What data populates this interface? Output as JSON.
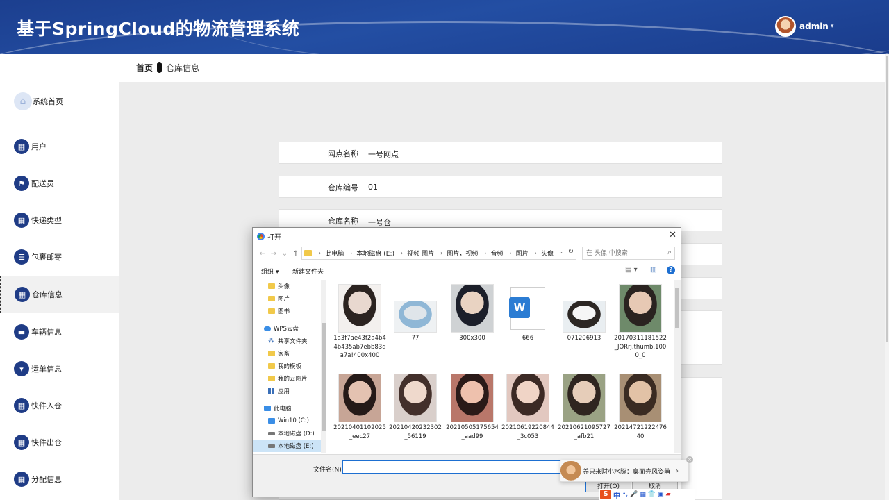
{
  "header": {
    "title": "基于SpringCloud的物流管理系统",
    "user_name": "admin",
    "caret": "▾"
  },
  "breadcrumb": {
    "home": "首页",
    "current": "仓库信息"
  },
  "sidebar": {
    "items": [
      {
        "label": "系统首页",
        "icon": "home-icon",
        "glyph": "⌂"
      },
      {
        "label": "用户",
        "icon": "grid-icon",
        "glyph": "▦"
      },
      {
        "label": "配送员",
        "icon": "flag-icon",
        "glyph": "⚑"
      },
      {
        "label": "快递类型",
        "icon": "grid-icon",
        "glyph": "▦"
      },
      {
        "label": "包裹邮寄",
        "icon": "list-icon",
        "glyph": "☰"
      },
      {
        "label": "仓库信息",
        "icon": "grid-icon",
        "glyph": "▦",
        "active": true
      },
      {
        "label": "车辆信息",
        "icon": "monitor-icon",
        "glyph": "▬"
      },
      {
        "label": "运单信息",
        "icon": "pin-icon",
        "glyph": "▾"
      },
      {
        "label": "快件入仓",
        "icon": "grid-icon",
        "glyph": "▦"
      },
      {
        "label": "快件出仓",
        "icon": "grid-icon",
        "glyph": "▦"
      },
      {
        "label": "分配信息",
        "icon": "grid-icon",
        "glyph": "▦"
      }
    ]
  },
  "form": {
    "rows": [
      {
        "label": "网点名称",
        "value": "一号网点"
      },
      {
        "label": "仓库编号",
        "value": "01"
      },
      {
        "label": "仓库名称",
        "value": "一号仓"
      }
    ]
  },
  "dialog": {
    "title": "打开",
    "close": "✕",
    "nav": {
      "back": "←",
      "forward": "→",
      "recent": "⌄",
      "up": "↑"
    },
    "address": [
      "此电脑",
      "本地磁盘 (E:)",
      "视频 图片",
      "图片，视频",
      "音频",
      "图片",
      "头像"
    ],
    "address_chev": "›",
    "address_dropdown": "⌄",
    "refresh": "↻",
    "search_placeholder": "在 头像 中搜索",
    "search_icon": "⌕",
    "toolbar": {
      "organize": "组织 ▾",
      "new_folder": "新建文件夹",
      "view": "▤ ▾",
      "pane": "▥",
      "help": "?"
    },
    "tree": [
      {
        "label": "头像",
        "icon": "folder"
      },
      {
        "label": "图片",
        "icon": "folder"
      },
      {
        "label": "图书",
        "icon": "folder"
      },
      {
        "label": "WPS云盘",
        "icon": "cloud"
      },
      {
        "label": "共享文件夹",
        "icon": "share"
      },
      {
        "label": "家畜",
        "icon": "folder"
      },
      {
        "label": "我的模板",
        "icon": "folder"
      },
      {
        "label": "我的云图片",
        "icon": "folder"
      },
      {
        "label": "应用",
        "icon": "apps"
      },
      {
        "label": "此电脑",
        "icon": "pc"
      },
      {
        "label": "Win10 (C:)",
        "icon": "drive"
      },
      {
        "label": "本地磁盘 (D:)",
        "icon": "drive"
      },
      {
        "label": "本地磁盘 (E:)",
        "icon": "drive",
        "selected": true
      }
    ],
    "files": [
      {
        "name": "1a3f7ae43f2a4b44b435ab7ebb83da7a!400x400",
        "kind": "photo",
        "colors": [
          "#f3f0ee",
          "#2b2320",
          "#e8d8cf"
        ]
      },
      {
        "name": "77",
        "kind": "wide",
        "colors": [
          "#eef1f3",
          "#8fb7d6",
          "#dfe5ea"
        ]
      },
      {
        "name": "300x300",
        "kind": "photo",
        "colors": [
          "#cfd2d4",
          "#1c1f2a",
          "#e9d3c2"
        ]
      },
      {
        "name": "666",
        "kind": "word"
      },
      {
        "name": "071206913",
        "kind": "wide",
        "colors": [
          "#e9eef1",
          "#2c2724",
          "#f6f6f6"
        ]
      },
      {
        "name": "20170311181522_JQRrj.thumb.1000_0",
        "kind": "photo",
        "colors": [
          "#6e8a6a",
          "#2a2320",
          "#e7c9b4"
        ]
      },
      {
        "name": "20210401102025_eec27",
        "kind": "photo",
        "colors": [
          "#c7a596",
          "#251a18",
          "#e4c2b1"
        ]
      },
      {
        "name": "20210420232302_56119",
        "kind": "photo",
        "colors": [
          "#d9cfcb",
          "#43302b",
          "#efd9cc"
        ]
      },
      {
        "name": "20210505175654_aad99",
        "kind": "photo",
        "colors": [
          "#b9776a",
          "#2a1a18",
          "#eec1ad"
        ]
      },
      {
        "name": "20210619220844_3c053",
        "kind": "photo",
        "colors": [
          "#e2c8c0",
          "#3c2a25",
          "#f0d4c6"
        ]
      },
      {
        "name": "20210621095727_afb21",
        "kind": "photo",
        "colors": [
          "#9aa284",
          "#2f2520",
          "#e6cdb9"
        ]
      },
      {
        "name": "2021472122247640",
        "kind": "photo",
        "colors": [
          "#a88f74",
          "#3a2b22",
          "#e2c2a6"
        ]
      }
    ],
    "filename_label": "文件名(N):",
    "filename_value": "",
    "open_button": "打开(O)",
    "cancel_button": "取消"
  },
  "ime": {
    "popup_text": "养只来财小水豚：桌面壳风姿萌",
    "popup_arrow": "›",
    "close": "×",
    "logo": "S",
    "mode": "中",
    "icons": [
      "•,",
      "🎤",
      "▦",
      "👕",
      "▣",
      "▰"
    ]
  }
}
